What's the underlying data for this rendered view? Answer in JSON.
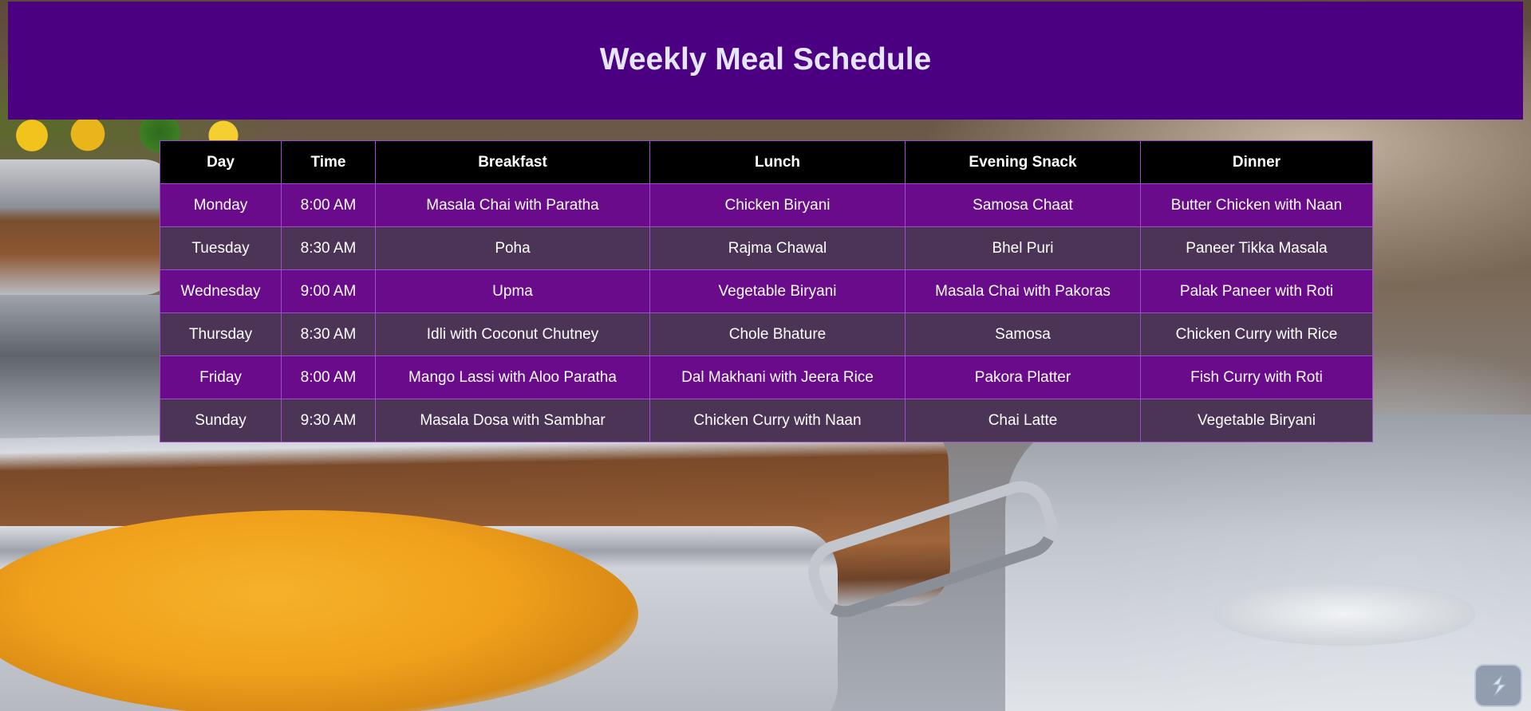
{
  "page": {
    "title": "Weekly Meal Schedule"
  },
  "colors": {
    "header_bg": "#4b0082",
    "title_text": "#e6e6fa",
    "table_header_bg": "#000000",
    "row_odd_bg": "#6a0b8c",
    "row_even_bg": "#4b3456",
    "border": "#9b4dcc"
  },
  "table": {
    "headers": [
      "Day",
      "Time",
      "Breakfast",
      "Lunch",
      "Evening Snack",
      "Dinner"
    ],
    "rows": [
      [
        "Monday",
        "8:00 AM",
        "Masala Chai with Paratha",
        "Chicken Biryani",
        "Samosa Chaat",
        "Butter Chicken with Naan"
      ],
      [
        "Tuesday",
        "8:30 AM",
        "Poha",
        "Rajma Chawal",
        "Bhel Puri",
        "Paneer Tikka Masala"
      ],
      [
        "Wednesday",
        "9:00 AM",
        "Upma",
        "Vegetable Biryani",
        "Masala Chai with Pakoras",
        "Palak Paneer with Roti"
      ],
      [
        "Thursday",
        "8:30 AM",
        "Idli with Coconut Chutney",
        "Chole Bhature",
        "Samosa",
        "Chicken Curry with Rice"
      ],
      [
        "Friday",
        "8:00 AM",
        "Mango Lassi with Aloo Paratha",
        "Dal Makhani with Jeera Rice",
        "Pakora Platter",
        "Fish Curry with Roti"
      ],
      [
        "Sunday",
        "9:30 AM",
        "Masala Dosa with Sambhar",
        "Chicken Curry with Naan",
        "Chai Latte",
        "Vegetable Biryani"
      ]
    ]
  },
  "widget": {
    "icon": "app-logo-icon"
  }
}
